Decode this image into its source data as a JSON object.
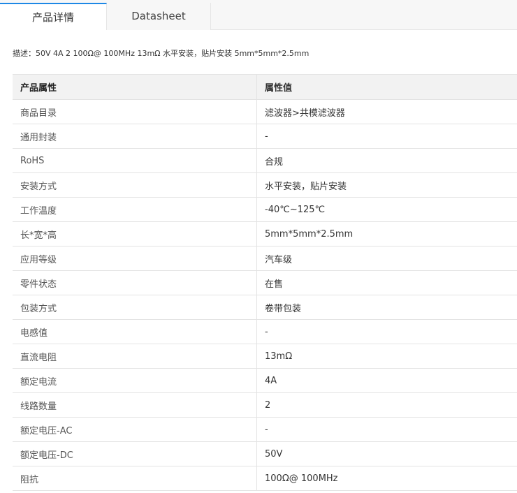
{
  "tabs": [
    {
      "label": "产品详情",
      "active": true
    },
    {
      "label": "Datasheet",
      "active": false
    }
  ],
  "description": "描述：50V 4A 2 100Ω@ 100MHz 13mΩ 水平安装，贴片安装 5mm*5mm*2.5mm",
  "table": {
    "headers": {
      "name": "产品属性",
      "value": "属性值"
    },
    "rows": [
      {
        "name": "商品目录",
        "value": "滤波器>共模滤波器"
      },
      {
        "name": "通用封装",
        "value": "-"
      },
      {
        "name": "RoHS",
        "value": "合规"
      },
      {
        "name": "安装方式",
        "value": "水平安装，贴片安装"
      },
      {
        "name": "工作温度",
        "value": "-40℃~125℃"
      },
      {
        "name": "长*宽*高",
        "value": "5mm*5mm*2.5mm"
      },
      {
        "name": "应用等级",
        "value": "汽车级"
      },
      {
        "name": "零件状态",
        "value": "在售"
      },
      {
        "name": "包装方式",
        "value": "卷带包装"
      },
      {
        "name": "电感值",
        "value": "-"
      },
      {
        "name": "直流电阻",
        "value": "13mΩ"
      },
      {
        "name": "额定电流",
        "value": "4A"
      },
      {
        "name": "线路数量",
        "value": "2"
      },
      {
        "name": "额定电压-AC",
        "value": "-"
      },
      {
        "name": "额定电压-DC",
        "value": "50V"
      },
      {
        "name": "阻抗",
        "value": "100Ω@ 100MHz"
      }
    ]
  },
  "colors": {
    "active_tab_accent": "#1e88e5",
    "header_bg": "#f2f2f2",
    "border": "#e3e3e3"
  }
}
